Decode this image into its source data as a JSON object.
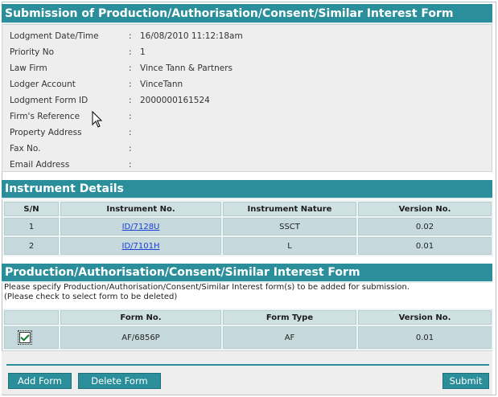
{
  "header": {
    "title": "Submission of Production/Authorisation/Consent/Similar Interest Form"
  },
  "lodgement": {
    "rows": [
      {
        "label": "Lodgment Date/Time",
        "colon": ":",
        "value": "16/08/2010 11:12:18am"
      },
      {
        "label": "Priority No",
        "colon": ":",
        "value": "1"
      },
      {
        "label": "Law Firm",
        "colon": ":",
        "value": "Vince Tann & Partners"
      },
      {
        "label": "Lodger Account",
        "colon": ":",
        "value": "VinceTann"
      },
      {
        "label": "Lodgment Form ID",
        "colon": ":",
        "value": "2000000161524"
      },
      {
        "label": "Firm's Reference",
        "colon": ":",
        "value": ""
      },
      {
        "label": "Property Address",
        "colon": ":",
        "value": ""
      },
      {
        "label": "Fax No.",
        "colon": ":",
        "value": ""
      },
      {
        "label": "Email Address",
        "colon": ":",
        "value": ""
      }
    ]
  },
  "instrument": {
    "title": "Instrument Details",
    "columns": [
      "S/N",
      "Instrument No.",
      "Instrument Nature",
      "Version No."
    ],
    "rows": [
      {
        "sn": "1",
        "no": "ID/7128U",
        "nature": "SSCT",
        "version": "0.02"
      },
      {
        "sn": "2",
        "no": "ID/7101H",
        "nature": "L",
        "version": "0.01"
      }
    ]
  },
  "forms": {
    "title": "Production/Authorisation/Consent/Similar Interest Form",
    "note_line1": "Please specify Production/Authorisation/Consent/Similar Interest form(s) to be added for submission.",
    "note_line2": "(Please check to select form to be deleted)",
    "columns": [
      "",
      "Form No.",
      "Form Type",
      "Version No."
    ],
    "rows": [
      {
        "checked": true,
        "form_no": "AF/6856P",
        "form_type": "AF",
        "version": "0.01"
      }
    ]
  },
  "buttons": {
    "add": "Add Form",
    "delete": "Delete Form",
    "submit": "Submit"
  },
  "colors": {
    "header": "#2a8f9a",
    "panel": "#eeeeee",
    "cell": "#c6dadd",
    "link": "#1a3fd1"
  }
}
